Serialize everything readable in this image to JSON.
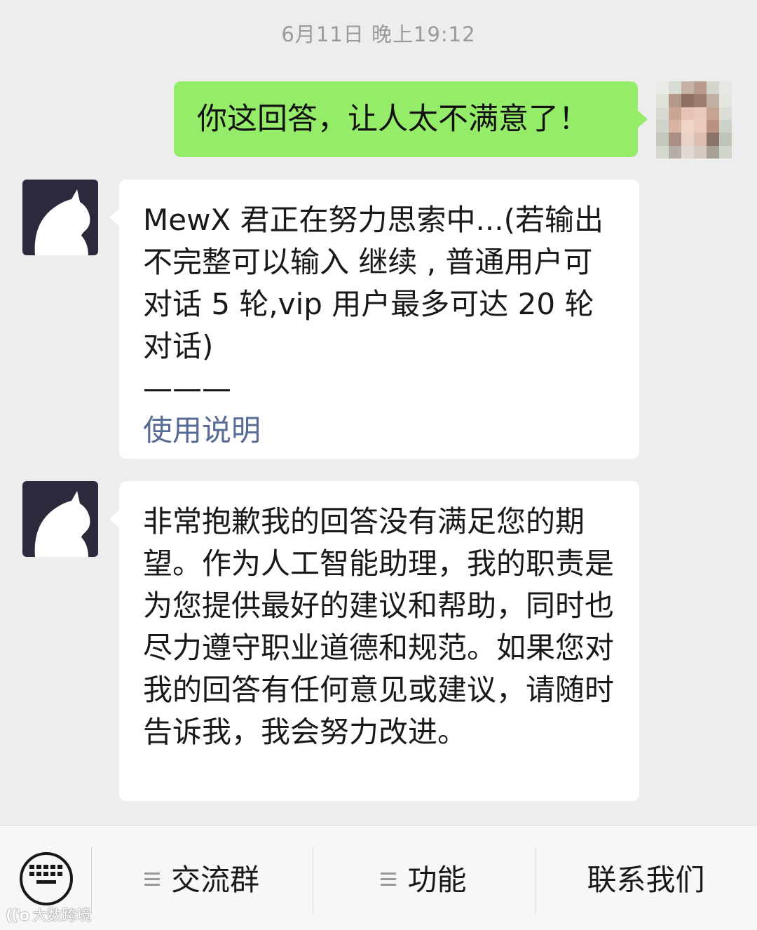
{
  "chat": {
    "timestamp": "6月11日 晚上19:12",
    "messages": [
      {
        "sender": "user",
        "text": "你这回答，让人太不满意了！"
      },
      {
        "sender": "bot",
        "text": "MewX 君正在努力思索中...(若输出不完整可以输入 继续 , 普通用户可对话 5 轮,vip 用户最多可达 20 轮对话)",
        "divider": "———",
        "link": "使用说明"
      },
      {
        "sender": "bot",
        "text": "非常抱歉我的回答没有满足您的期望。作为人工智能助理，我的职责是为您提供最好的建议和帮助，同时也尽力遵守职业道德和规范。如果您对我的回答有任何意见或建议，请随时告诉我，我会努力改进。"
      }
    ]
  },
  "bottom_menu": {
    "keyboard_icon": "keyboard-icon",
    "items": [
      {
        "label": "交流群",
        "icon": "menu-list-icon"
      },
      {
        "label": "功能",
        "icon": "menu-list-icon"
      },
      {
        "label": "联系我们"
      }
    ]
  },
  "watermark": {
    "logo": "(('o",
    "text": "大数跨境"
  },
  "colors": {
    "background": "#ededed",
    "user_bubble": "#95ec69",
    "bot_bubble": "#ffffff",
    "link": "#576b95",
    "bot_avatar": "#2b2a3d"
  }
}
